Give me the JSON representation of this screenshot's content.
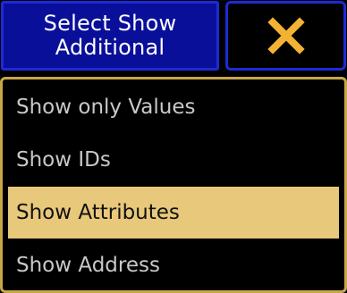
{
  "header": {
    "title": "Select Show\nAdditional",
    "close_icon": "close-x-icon",
    "close_icon_color": "#f2b233"
  },
  "options": {
    "items": [
      {
        "label": "Show only Values",
        "selected": false
      },
      {
        "label": "Show IDs",
        "selected": false
      },
      {
        "label": "Show Attributes",
        "selected": true
      },
      {
        "label": "Show Address",
        "selected": false
      }
    ]
  },
  "colors": {
    "title_bg": "#0a0f9a",
    "title_border": "#1b2bd6",
    "list_border": "#c9a64c",
    "selected_bg": "#e8c87a",
    "item_text": "#c8c8c8"
  }
}
